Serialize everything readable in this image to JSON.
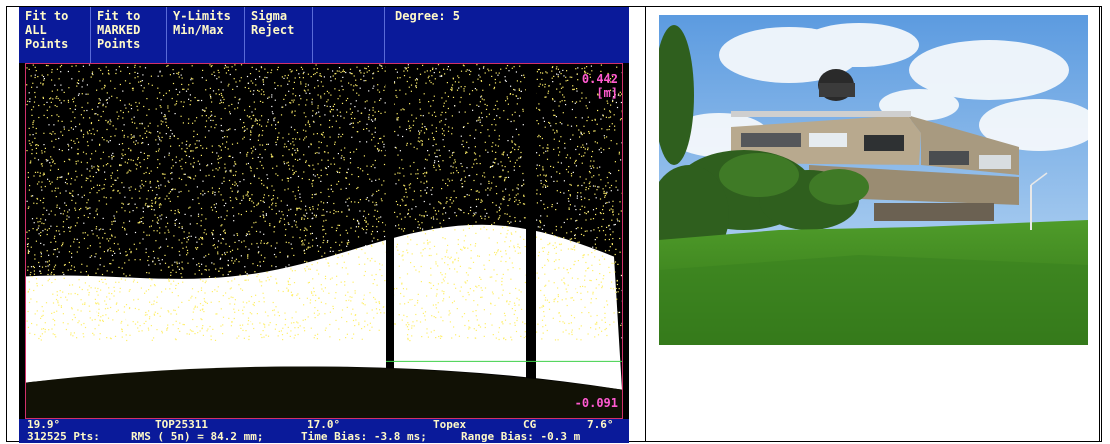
{
  "toolbar": {
    "buttons": [
      {
        "lines": [
          "Fit to",
          "ALL",
          "Points"
        ]
      },
      {
        "lines": [
          "Fit to",
          "MARKED",
          "Points"
        ]
      },
      {
        "lines": [
          "Y-Limits",
          "Min/Max"
        ]
      },
      {
        "lines": [
          "Sigma",
          "Reject"
        ]
      },
      {
        "lines": [
          ""
        ]
      }
    ],
    "degree_label": "Degree: 5"
  },
  "plot": {
    "top_value": "0.442",
    "top_unit": "[m]",
    "bottom_value": "-0.091",
    "colors": {
      "points": "#ffef6a",
      "dense": "#ffffff",
      "background": "#000000",
      "border": "#d0306a"
    }
  },
  "status": {
    "row1": {
      "left_angle": "19.9°",
      "pass_id": "TOP25311",
      "mid_angle": "17.0°",
      "satellite": "Topex",
      "mode": "CG",
      "right_angle": "7.6°"
    },
    "row2": {
      "points": "312525 Pts:",
      "rms": "RMS ( 5n) =  84.2 mm;",
      "time_bias": "Time Bias:   -3.8 ms;",
      "range_bias": "Range Bias:  -0.3 m"
    }
  }
}
